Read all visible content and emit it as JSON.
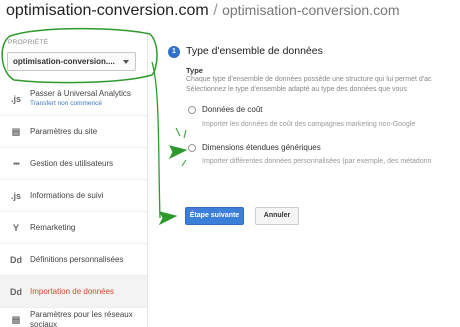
{
  "header": {
    "site_name": "optimisation-conversion.com",
    "separator": "/",
    "property_name": "optimisation-conversion.com"
  },
  "sidebar": {
    "property_label": "PROPRIÉTÉ",
    "property_select_value": "optimisation-conversion....",
    "items": [
      {
        "icon": "js-icon",
        "glyph": ".js",
        "label": "Passer à Universal Analytics",
        "sublabel": "Transfert non commencé"
      },
      {
        "icon": "settings-page-icon",
        "glyph": "▤",
        "label": "Paramètres du site"
      },
      {
        "icon": "users-icon",
        "glyph": "●●●",
        "label": "Gestion des utilisateurs"
      },
      {
        "icon": "js-icon",
        "glyph": ".js",
        "label": "Informations de suivi"
      },
      {
        "icon": "remarketing-icon",
        "glyph": "Y",
        "label": "Remarketing"
      },
      {
        "icon": "dd-icon",
        "glyph": "Dd",
        "label": "Définitions personnalisées"
      },
      {
        "icon": "dd-icon",
        "glyph": "Dd",
        "label": "Importation de données",
        "active": true
      },
      {
        "icon": "social-settings-icon",
        "glyph": "▤",
        "label": "Paramètres pour les réseaux sociaux"
      }
    ]
  },
  "main": {
    "step_number": "1",
    "step_title": "Type d'ensemble de données",
    "type_label": "Type",
    "description_line1": "Chaque type d'ensemble de données possède une structure qui lui permet d'ac",
    "description_line2": "Sélectionnez le type d'ensemble adapté au type des données que vous",
    "options": [
      {
        "label": "Données de coût",
        "description": "Importer les données de coût des campagnes marketing non-Google"
      },
      {
        "label": "Dimensions étendues génériques",
        "description": "Importer différentes données personnalisées (par exemple, des métadonn"
      }
    ],
    "next_button": "Étape suivante",
    "cancel_button": "Annuler"
  },
  "colors": {
    "accent": "#3b7fd9",
    "active_nav": "#d2492a",
    "annotation": "#2e9a2e"
  }
}
